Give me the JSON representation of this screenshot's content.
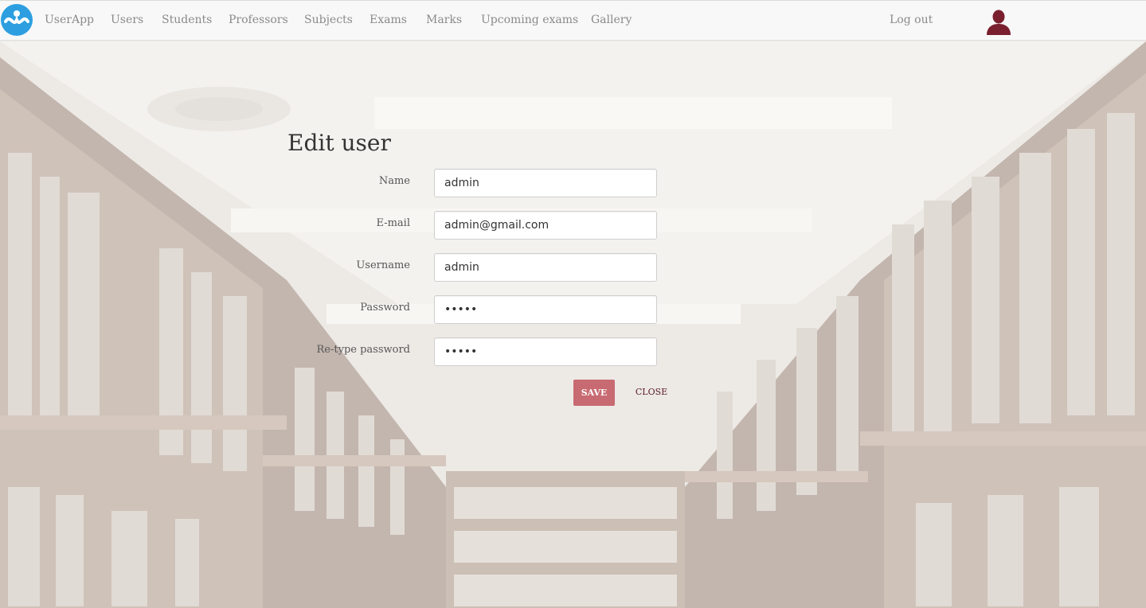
{
  "navbar": {
    "brand": "UserApp",
    "items": [
      {
        "label": "Users"
      },
      {
        "label": "Students"
      },
      {
        "label": "Professors"
      },
      {
        "label": "Subjects"
      },
      {
        "label": "Exams"
      },
      {
        "label": "Marks"
      },
      {
        "label": "Upcoming exams"
      },
      {
        "label": "Gallery"
      }
    ],
    "logout": "Log out",
    "logo_icon": "app-logo-icon",
    "avatar_icon": "user-avatar-icon"
  },
  "form": {
    "title": "Edit user",
    "fields": [
      {
        "label": "Name",
        "value": "admin",
        "type": "text"
      },
      {
        "label": "E-mail",
        "value": "admin@gmail.com",
        "type": "text"
      },
      {
        "label": "Username",
        "value": "admin",
        "type": "text"
      },
      {
        "label": "Password",
        "value": "admin",
        "type": "password"
      },
      {
        "label": "Re-type password",
        "value": "admin",
        "type": "password"
      }
    ],
    "save_label": "SAVE",
    "close_label": "CLOSE"
  },
  "colors": {
    "logo_blue": "#2d9fe0",
    "avatar_maroon": "#7a1f2e",
    "save_button": "#c86a72",
    "close_text": "#5a1a24",
    "nav_text": "#8a8a8a"
  }
}
